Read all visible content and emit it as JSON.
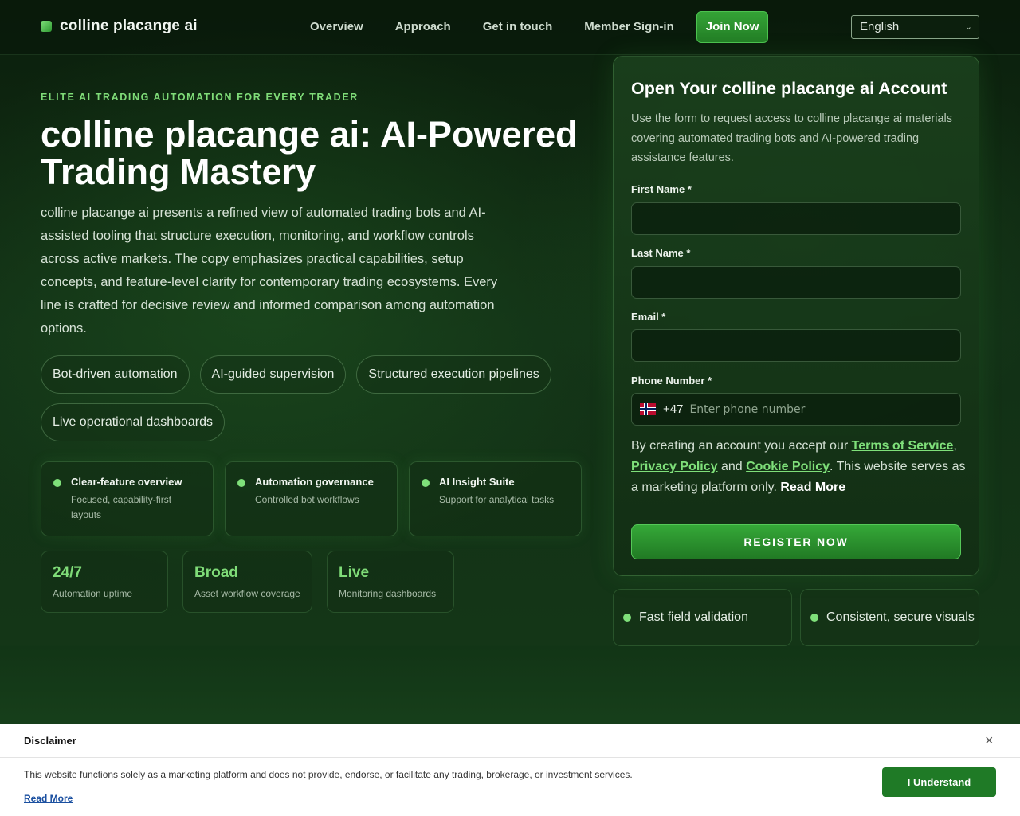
{
  "header": {
    "brand": "colline placange ai",
    "nav": [
      "Overview",
      "Approach",
      "Get in touch",
      "Member Sign-in"
    ],
    "join_label": "Join Now",
    "language": "English"
  },
  "hero": {
    "eyebrow": "ELITE AI TRADING AUTOMATION FOR EVERY TRADER",
    "title": "colline placange ai: AI-Powered Trading Mastery",
    "text": "colline placange ai presents a refined view of automated trading bots and AI-assisted tooling that structure execution, monitoring, and workflow controls across active markets. The copy emphasizes practical capabilities, setup concepts, and feature-level clarity for contemporary trading ecosystems. Every line is crafted for decisive review and informed comparison among automation options.",
    "chips": [
      "Bot-driven automation",
      "AI-guided supervision",
      "Structured execution pipelines",
      "Live operational dashboards"
    ],
    "features": [
      {
        "title": "Clear-feature overview",
        "sub": "Focused, capability-first layouts"
      },
      {
        "title": "Automation governance",
        "sub": "Controlled bot workflows"
      },
      {
        "title": "AI Insight Suite",
        "sub": "Support for analytical tasks"
      }
    ],
    "stats": [
      {
        "value": "24/7",
        "label": "Automation uptime"
      },
      {
        "value": "Broad",
        "label": "Asset workflow coverage"
      },
      {
        "value": "Live",
        "label": "Monitoring dashboards"
      }
    ]
  },
  "form": {
    "title": "Open Your colline placange ai Account",
    "desc": "Use the form to request access to colline placange ai materials covering automated trading bots and AI-powered trading assistance features.",
    "first_name_label": "First Name *",
    "last_name_label": "Last Name *",
    "email_label": "Email *",
    "phone_label": "Phone Number *",
    "dial_code": "+47",
    "phone_placeholder": "Enter phone number",
    "consent_prefix": "By creating an account you accept our",
    "terms": "Terms of Service",
    "privacy": "Privacy Policy",
    "and": "and",
    "cookie": "Cookie Policy",
    "consent_suffix": ". This website serves as a marketing platform only.",
    "read_more": "Read More",
    "register_label": "REGISTER NOW"
  },
  "mini_cards": [
    "Fast field validation",
    "Consistent, secure visuals"
  ],
  "disclaimer": {
    "title": "Disclaimer",
    "text": "This website functions solely as a marketing platform and does not provide, endorse, or facilitate any trading, brokerage, or investment services.",
    "read_more": "Read More",
    "button": "I Understand",
    "close": "×"
  }
}
